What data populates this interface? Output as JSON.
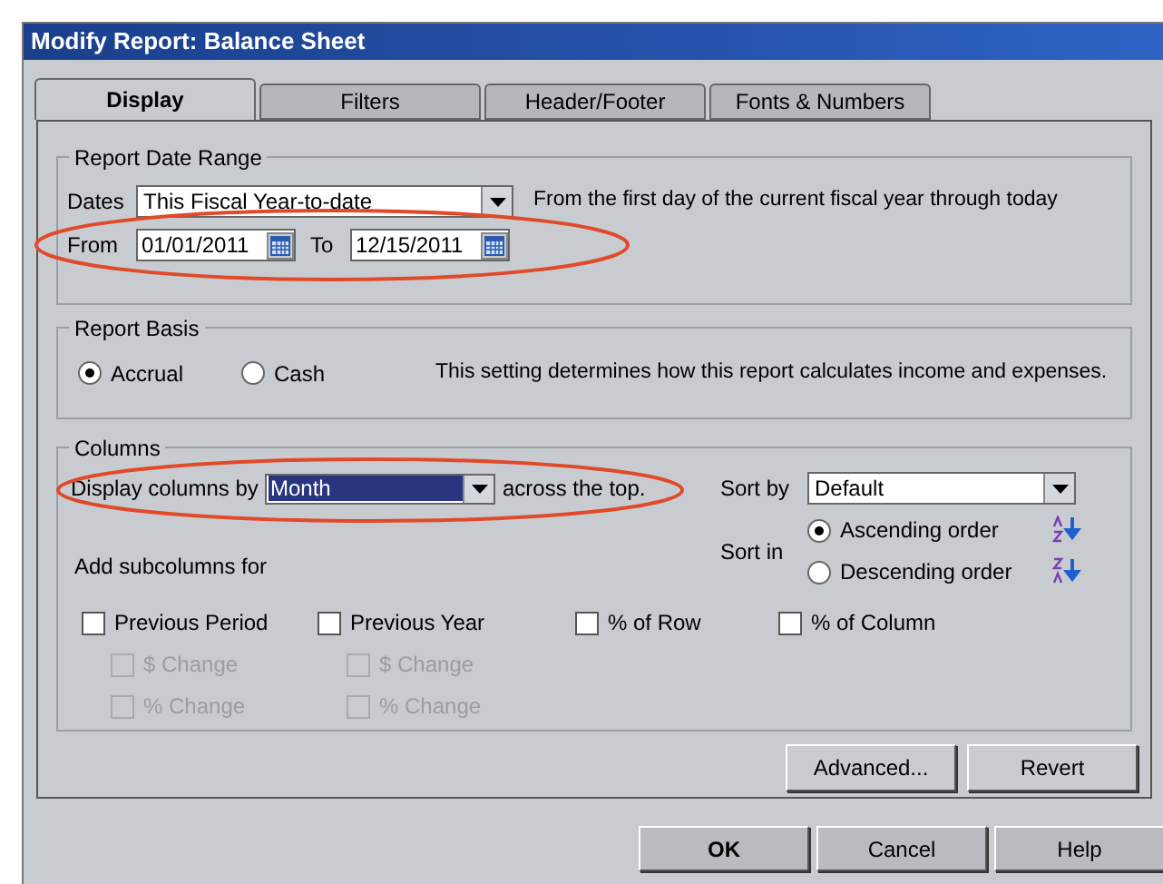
{
  "window": {
    "title": "Modify Report: Balance Sheet"
  },
  "tabs": [
    {
      "label": "Display",
      "selected": true
    },
    {
      "label": "Filters",
      "selected": false
    },
    {
      "label": "Header/Footer",
      "selected": false
    },
    {
      "label": "Fonts & Numbers",
      "selected": false
    }
  ],
  "date_range": {
    "title": "Report Date Range",
    "dates_label": "Dates",
    "dates_value": "This Fiscal Year-to-date",
    "description": "From the first day of the current fiscal year through today",
    "from_label": "From",
    "from_value": "01/01/2011",
    "to_label": "To",
    "to_value": "12/15/2011"
  },
  "basis": {
    "title": "Report Basis",
    "options": [
      {
        "label": "Accrual",
        "selected": true
      },
      {
        "label": "Cash",
        "selected": false
      }
    ],
    "description": "This setting determines how this report calculates income and expenses."
  },
  "columns": {
    "title": "Columns",
    "display_label": "Display columns by",
    "display_value": "Month",
    "display_focused": true,
    "display_suffix": "across the top.",
    "sort_by_label": "Sort by",
    "sort_by_value": "Default",
    "sort_in_label": "Sort in",
    "sort_orders": [
      {
        "label": "Ascending order",
        "selected": true,
        "kind": "ascending"
      },
      {
        "label": "Descending order",
        "selected": false,
        "kind": "descending"
      }
    ],
    "subcolumns_label": "Add subcolumns for",
    "subcolumns": [
      {
        "label": "Previous Period",
        "checked": false,
        "children": [
          {
            "label": "$ Change",
            "checked": false,
            "disabled": true
          },
          {
            "label": "% Change",
            "checked": false,
            "disabled": true
          }
        ]
      },
      {
        "label": "Previous Year",
        "checked": false,
        "children": [
          {
            "label": "$ Change",
            "checked": false,
            "disabled": true
          },
          {
            "label": "% Change",
            "checked": false,
            "disabled": true
          }
        ]
      },
      {
        "label": "% of Row",
        "checked": false
      },
      {
        "label": "% of Column",
        "checked": false
      }
    ]
  },
  "panel_buttons": [
    "Advanced...",
    "Revert"
  ],
  "footer_buttons": [
    {
      "label": "OK",
      "default": true
    },
    {
      "label": "Cancel",
      "default": false
    },
    {
      "label": "Help",
      "default": false
    }
  ]
}
